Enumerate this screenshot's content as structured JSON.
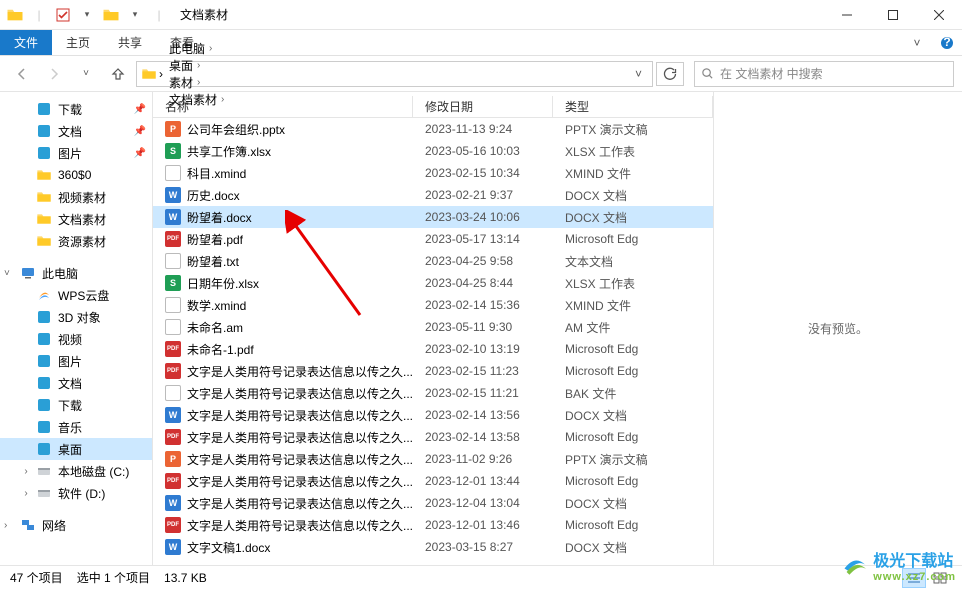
{
  "window": {
    "title": "文档素材"
  },
  "ribbon": {
    "file": "文件",
    "home": "主页",
    "share": "共享",
    "view": "查看"
  },
  "breadcrumbs": [
    "此电脑",
    "桌面",
    "素材",
    "文档素材"
  ],
  "search": {
    "placeholder": "在 文档素材 中搜索"
  },
  "nav": {
    "quick": [
      {
        "label": "下载",
        "icon": "download",
        "pinned": true
      },
      {
        "label": "文档",
        "icon": "document",
        "pinned": true
      },
      {
        "label": "图片",
        "icon": "picture",
        "pinned": true
      },
      {
        "label": "360$0",
        "icon": "folder",
        "pinned": false
      },
      {
        "label": "视频素材",
        "icon": "folder",
        "pinned": false
      },
      {
        "label": "文档素材",
        "icon": "folder",
        "pinned": false
      },
      {
        "label": "资源素材",
        "icon": "folder",
        "pinned": false
      }
    ],
    "thispc_label": "此电脑",
    "thispc": [
      {
        "label": "WPS云盘",
        "icon": "wps"
      },
      {
        "label": "3D 对象",
        "icon": "3d"
      },
      {
        "label": "视频",
        "icon": "video"
      },
      {
        "label": "图片",
        "icon": "picture"
      },
      {
        "label": "文档",
        "icon": "document"
      },
      {
        "label": "下载",
        "icon": "download"
      },
      {
        "label": "音乐",
        "icon": "music"
      },
      {
        "label": "桌面",
        "icon": "desktop",
        "selected": true
      },
      {
        "label": "本地磁盘 (C:)",
        "icon": "drive",
        "expandable": true
      },
      {
        "label": "软件 (D:)",
        "icon": "drive",
        "expandable": true
      }
    ],
    "network_label": "网络"
  },
  "columns": {
    "name": "名称",
    "date": "修改日期",
    "type": "类型"
  },
  "files": [
    {
      "name": "公司年会组织.pptx",
      "date": "2023-11-13 9:24",
      "type": "PPTX 演示文稿",
      "ico": "pptx"
    },
    {
      "name": "共享工作簿.xlsx",
      "date": "2023-05-16 10:03",
      "type": "XLSX 工作表",
      "ico": "xlsx"
    },
    {
      "name": "科目.xmind",
      "date": "2023-02-15 10:34",
      "type": "XMIND 文件",
      "ico": "blank"
    },
    {
      "name": "历史.docx",
      "date": "2023-02-21 9:37",
      "type": "DOCX 文档",
      "ico": "docx"
    },
    {
      "name": "盼望着.docx",
      "date": "2023-03-24 10:06",
      "type": "DOCX 文档",
      "ico": "docx",
      "selected": true
    },
    {
      "name": "盼望着.pdf",
      "date": "2023-05-17 13:14",
      "type": "Microsoft Edg",
      "ico": "pdf"
    },
    {
      "name": "盼望着.txt",
      "date": "2023-04-25 9:58",
      "type": "文本文档",
      "ico": "txt"
    },
    {
      "name": "日期年份.xlsx",
      "date": "2023-04-25 8:44",
      "type": "XLSX 工作表",
      "ico": "xlsx"
    },
    {
      "name": "数学.xmind",
      "date": "2023-02-14 15:36",
      "type": "XMIND 文件",
      "ico": "blank"
    },
    {
      "name": "未命名.am",
      "date": "2023-05-11 9:30",
      "type": "AM 文件",
      "ico": "blank"
    },
    {
      "name": "未命名-1.pdf",
      "date": "2023-02-10 13:19",
      "type": "Microsoft Edg",
      "ico": "pdf"
    },
    {
      "name": "文字是人类用符号记录表达信息以传之久...",
      "date": "2023-02-15 11:23",
      "type": "Microsoft Edg",
      "ico": "pdf"
    },
    {
      "name": "文字是人类用符号记录表达信息以传之久...",
      "date": "2023-02-15 11:21",
      "type": "BAK 文件",
      "ico": "blank"
    },
    {
      "name": "文字是人类用符号记录表达信息以传之久...",
      "date": "2023-02-14 13:56",
      "type": "DOCX 文档",
      "ico": "docx"
    },
    {
      "name": "文字是人类用符号记录表达信息以传之久...",
      "date": "2023-02-14 13:58",
      "type": "Microsoft Edg",
      "ico": "pdf"
    },
    {
      "name": "文字是人类用符号记录表达信息以传之久...",
      "date": "2023-11-02 9:26",
      "type": "PPTX 演示文稿",
      "ico": "pptx"
    },
    {
      "name": "文字是人类用符号记录表达信息以传之久...",
      "date": "2023-12-01 13:44",
      "type": "Microsoft Edg",
      "ico": "pdf"
    },
    {
      "name": "文字是人类用符号记录表达信息以传之久...",
      "date": "2023-12-04 13:04",
      "type": "DOCX 文档",
      "ico": "docx"
    },
    {
      "name": "文字是人类用符号记录表达信息以传之久...",
      "date": "2023-12-01 13:46",
      "type": "Microsoft Edg",
      "ico": "pdf"
    },
    {
      "name": "文字文稿1.docx",
      "date": "2023-03-15 8:27",
      "type": "DOCX 文档",
      "ico": "docx"
    }
  ],
  "preview_text": "没有预览。",
  "status": {
    "count": "47 个项目",
    "selection": "选中 1 个项目",
    "size": "13.7 KB"
  },
  "watermark": {
    "name": "极光下载站",
    "url": "www.xz7.com"
  },
  "icon_colors": {
    "pptx": "#eb6434",
    "xlsx": "#1f9e55",
    "docx": "#2f7bd1",
    "pdf": "#d13131",
    "txt": "#888",
    "blank": "#bbb"
  },
  "icon_text": {
    "pptx": "P",
    "xlsx": "S",
    "docx": "W",
    "pdf": "PDF",
    "txt": "",
    "blank": ""
  }
}
